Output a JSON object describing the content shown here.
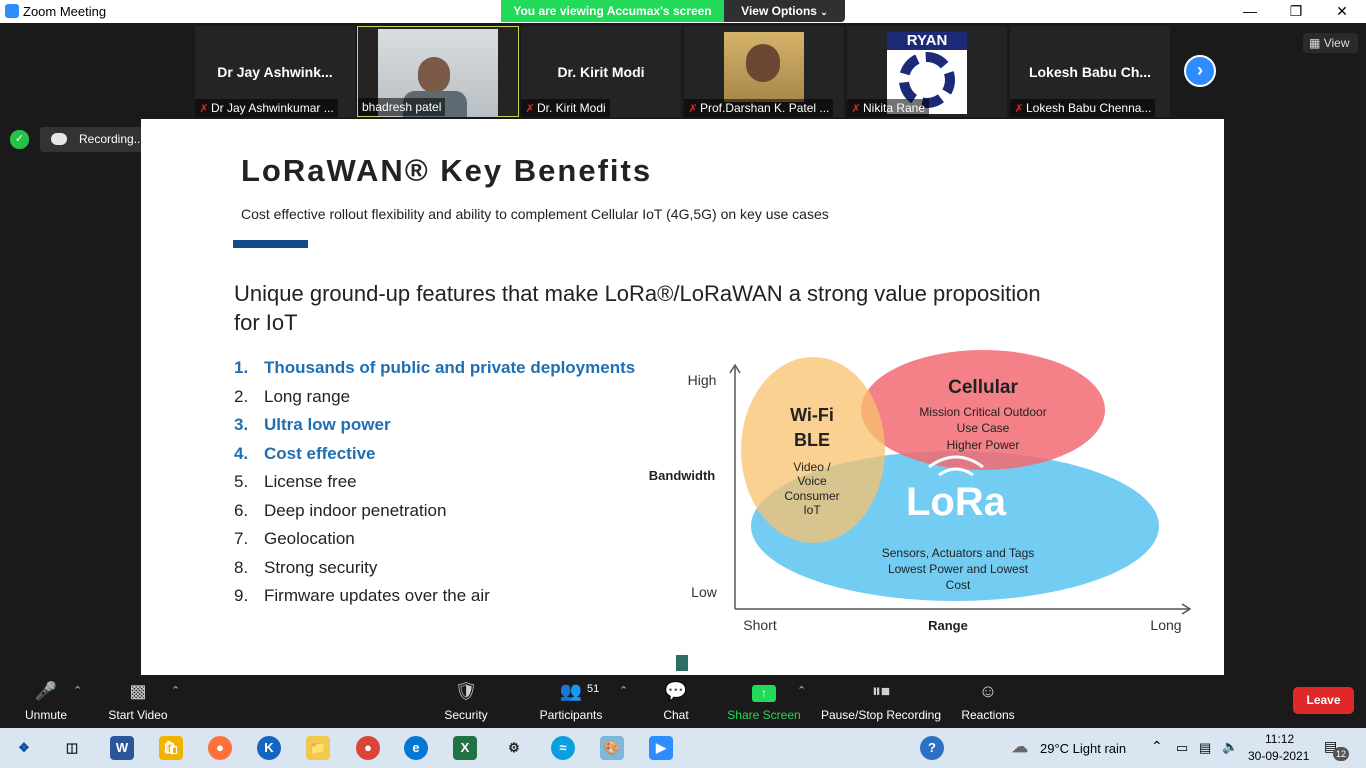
{
  "window": {
    "title": "Zoom Meeting"
  },
  "share_banner": {
    "viewing_text": "You are viewing Accumax's screen",
    "view_options": "View Options"
  },
  "participants_strip": [
    {
      "display": "Dr Jay Ashwink...",
      "label": "Dr Jay Ashwinkumar ...",
      "muted": true,
      "video": false
    },
    {
      "display": "",
      "label": "bhadresh patel",
      "muted": false,
      "video": true
    },
    {
      "display": "Dr. Kirit Modi",
      "label": "Dr. Kirit Modi",
      "muted": true,
      "video": false
    },
    {
      "display": "",
      "label": "Prof.Darshan K. Patel ...",
      "muted": true,
      "video": true
    },
    {
      "display": "",
      "label": "Nikita Rane",
      "muted": true,
      "video": true,
      "logo_text": "RYAN"
    },
    {
      "display": "Lokesh Babu Ch...",
      "label": "Lokesh Babu Chenna...",
      "muted": true,
      "video": false
    }
  ],
  "view_button": "View",
  "recording": {
    "label": "Recording..."
  },
  "slide": {
    "heading": "LoRaWAN® Key Benefits",
    "subtitle": "Cost effective rollout flexibility and ability to complement Cellular IoT (4G,5G) on key use cases",
    "lead": "Unique ground-up features that make LoRa®/LoRaWAN a strong value proposition for IoT",
    "benefits": [
      {
        "num": "1.",
        "text": "Thousands of public and private deployments",
        "highlight": true
      },
      {
        "num": "2.",
        "text": "Long range",
        "highlight": false
      },
      {
        "num": "3.",
        "text": "Ultra low power",
        "highlight": true
      },
      {
        "num": "4.",
        "text": "Cost effective",
        "highlight": true
      },
      {
        "num": "5.",
        "text": "License free",
        "highlight": false
      },
      {
        "num": "6.",
        "text": "Deep indoor penetration",
        "highlight": false
      },
      {
        "num": "7.",
        "text": "Geolocation",
        "highlight": false
      },
      {
        "num": "8.",
        "text": "Strong security",
        "highlight": false
      },
      {
        "num": "9.",
        "text": "Firmware updates over the air",
        "highlight": false
      }
    ],
    "diagram": {
      "y_axis": "Bandwidth",
      "y_high": "High",
      "y_low": "Low",
      "x_axis": "Range",
      "x_short": "Short",
      "x_long": "Long",
      "wifi": {
        "title1": "Wi-Fi",
        "title2": "BLE",
        "desc": [
          "Video /",
          "Voice",
          "Consumer",
          "IoT"
        ],
        "color": "#f9c16e"
      },
      "cellular": {
        "title": "Cellular",
        "desc": [
          "Mission Critical Outdoor",
          "Use Case",
          "Higher Power"
        ],
        "color": "#f26b72"
      },
      "lora": {
        "title": "LoRa",
        "desc": [
          "Sensors, Actuators and Tags",
          "Lowest Power and Lowest",
          "Cost"
        ],
        "color": "#5bc3f0"
      }
    }
  },
  "toolbar": {
    "unmute": "Unmute",
    "start_video": "Start Video",
    "security": "Security",
    "participants": "Participants",
    "participants_count": "51",
    "chat": "Chat",
    "share_screen": "Share Screen",
    "pause_stop": "Pause/Stop Recording",
    "reactions": "Reactions",
    "leave": "Leave"
  },
  "taskbar": {
    "weather": "29°C  Light rain",
    "time": "11:12",
    "date": "30-09-2021",
    "notifications": "12"
  }
}
